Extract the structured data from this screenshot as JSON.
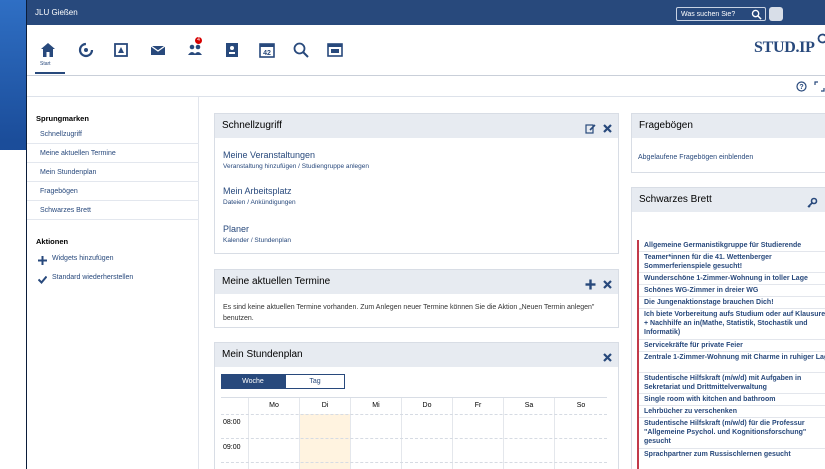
{
  "topbar": {
    "brand": "JLU Gießen",
    "search_placeholder": "Was suchen Sie?"
  },
  "nav": {
    "start_label": "Start",
    "mail_badge": "4",
    "logo_text": "STUD.IP"
  },
  "sidebar": {
    "heading_sprung": "Sprungmarken",
    "sprung_items": [
      "Schnellzugriff",
      "Meine aktuellen Termine",
      "Mein Stundenplan",
      "Fragebögen",
      "Schwarzes Brett"
    ],
    "heading_aktionen": "Aktionen",
    "aktionen": [
      {
        "label": "Widgets hinzufügen",
        "icon": "plus-icon"
      },
      {
        "label": "Standard wiederherstellen",
        "icon": "checkmark-icon"
      }
    ]
  },
  "schnellzugriff": {
    "title": "Schnellzugriff",
    "links": [
      {
        "title": "Meine Veranstaltungen",
        "sub": "Veranstaltung hinzufügen / Studiengruppe anlegen"
      },
      {
        "title": "Mein Arbeitsplatz",
        "sub": "Dateien / Ankündigungen"
      },
      {
        "title": "Planer",
        "sub": "Kalender / Stundenplan"
      }
    ]
  },
  "termine": {
    "title": "Meine aktuellen Termine",
    "text": "Es sind keine aktuellen Termine vorhanden. Zum Anlegen neuer Termine können Sie die Aktion „Neuen Termin anlegen\" benutzen."
  },
  "stundenplan": {
    "title": "Mein Stundenplan",
    "toggle_woche": "Woche",
    "toggle_tag": "Tag",
    "days": [
      "Mo",
      "Di",
      "Mi",
      "Do",
      "Fr",
      "Sa",
      "So"
    ],
    "times": [
      "08:00",
      "09:00"
    ]
  },
  "frageboegen": {
    "title": "Fragebögen",
    "link": "Abgelaufene Fragebögen einblenden"
  },
  "brett": {
    "title": "Schwarzes Brett",
    "entries": [
      "Allgemeine Germanistikgruppe für Studierende",
      "Teamer*innen für die 41. Wettenberger Sommerferienspiele gesucht!",
      "Wunderschöne 1-Zimmer-Wohnung in toller Lage",
      "Schönes WG-Zimmer in dreier WG",
      "Die Jungenaktionstage brauchen Dich!",
      "Ich biete Vorbereitung aufs Studium oder auf Klausuren + Nachhilfe an in(Mathe, Statistik, Stochastik und Informatik)",
      "Servicekräfte für private Feier",
      "Zentrale 1-Zimmer-Wohnung mit Charme in ruhiger Lage",
      "Studentische Hilfskraft (m/w/d) mit Aufgaben in Sekretariat und Drittmittelverwaltung",
      "Single room with kitchen and bathroom",
      "Lehrbücher zu verschenken",
      "Studentische Hilfskraft (m/w/d) für die Professur \"Allgemeine Psychol. und Kognitionsforschung\" gesucht",
      "Sprachpartner zum Russischlernen gesucht"
    ]
  },
  "colors": {
    "primary": "#28497c",
    "badge": "#d60000",
    "highlight": "#fff3e0"
  }
}
